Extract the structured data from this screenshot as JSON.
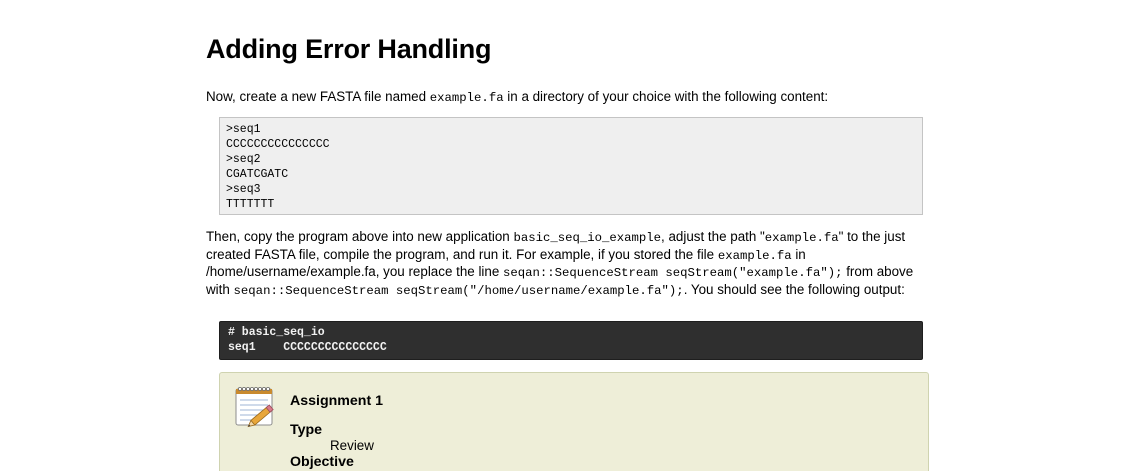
{
  "heading": "Adding Error Handling",
  "para1": {
    "before": "Now, create a new FASTA file named ",
    "code": "example.fa",
    "after": " in a directory of your choice with the following content:"
  },
  "fasta_lines": [
    ">seq1",
    "CCCCCCCCCCCCCCC",
    ">seq2",
    "CGATCGATC",
    ">seq3",
    "TTTTTTT"
  ],
  "para2": {
    "t1": "Then, copy the program above into new application ",
    "c1": "basic_seq_io_example",
    "t2": ", adjust the path \"",
    "c2": "example.fa",
    "t3": "\" to the just created FASTA file, compile the program, and run it. For example, if you stored the file ",
    "c3": "example.fa",
    "t4": " in ",
    "c4": "/home/username/example.fa",
    "t5": ", you replace the line ",
    "c5": "seqan::SequenceStream seqStream(\"example.fa\");",
    "t6": " from above with ",
    "c6": "seqan::SequenceStream seqStream(\"/home/username/example.fa\");",
    "t7": ". You should see the following output:"
  },
  "console_lines": [
    "# basic_seq_io",
    "seq1    CCCCCCCCCCCCCCC"
  ],
  "assignment": {
    "title": "Assignment 1",
    "type_label": "Type",
    "type_value": "Review",
    "objective_label": "Objective"
  }
}
